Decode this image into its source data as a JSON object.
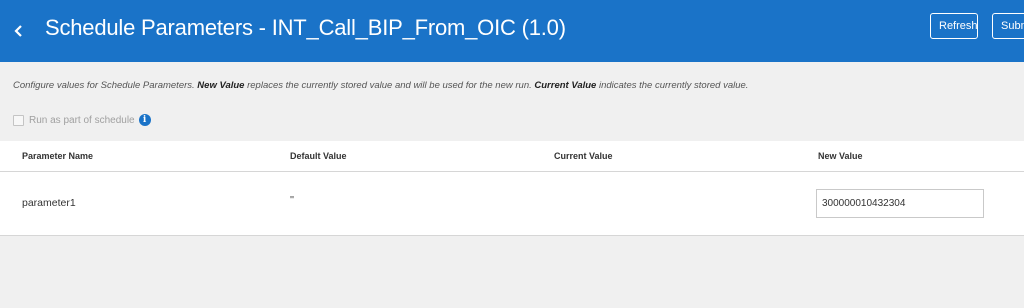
{
  "header": {
    "title": "Schedule Parameters - INT_Call_BIP_From_OIC (1.0)",
    "refresh_label": "Refresh",
    "submit_label": "Submit",
    "color": "#1a73c8"
  },
  "description": {
    "part1": "Configure values for Schedule Parameters. ",
    "new_value_term": "New Value",
    "part2": " replaces the currently stored value and will be used for the new run. ",
    "current_value_term": "Current Value",
    "part3": " indicates the currently stored value."
  },
  "schedule_option": {
    "label": "Run as part of schedule",
    "checked": false
  },
  "table": {
    "columns": [
      "Parameter Name",
      "Default Value",
      "Current Value",
      "New Value"
    ],
    "rows": [
      {
        "parameter_name": "parameter1",
        "default_value": "''",
        "current_value": "",
        "new_value": "300000010432304"
      }
    ]
  }
}
